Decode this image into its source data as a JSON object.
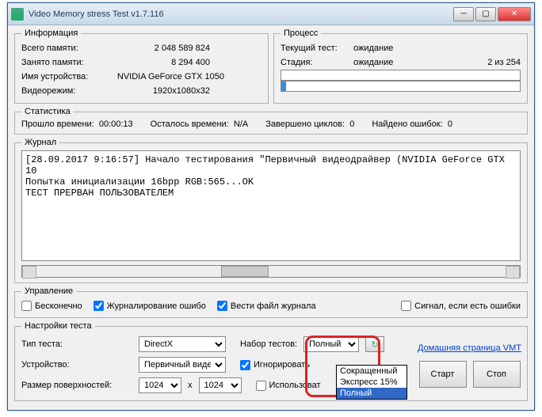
{
  "title": "Video Memory stress Test v1.7.116",
  "info": {
    "legend": "Информация",
    "mem_total_lbl": "Всего памяти:",
    "mem_total": "2 048 589 824",
    "mem_used_lbl": "Занято памяти:",
    "mem_used": "8 294 400",
    "device_lbl": "Имя устройства:",
    "device": "NVIDIA GeForce GTX 1050",
    "mode_lbl": "Видеорежим:",
    "mode": "1920x1080x32"
  },
  "process": {
    "legend": "Процесс",
    "cur_lbl": "Текущий тест:",
    "cur": "ожидание",
    "stage_lbl": "Стадия:",
    "stage": "ожидание",
    "count": "2 из 254"
  },
  "stats": {
    "legend": "Статистика",
    "elapsed_lbl": "Прошло времени:",
    "elapsed": "00:00:13",
    "remain_lbl": "Осталось времени:",
    "remain": "N/A",
    "cycles_lbl": "Завершено циклов:",
    "cycles": "0",
    "errors_lbl": "Найдено ошибок:",
    "errors": "0"
  },
  "log": {
    "legend": "Журнал",
    "text": "[28.09.2017 9:16:57] Начало тестирования \"Первичный видеодрайвер (NVIDIA GeForce GTX 10\nПопытка инициализации 16bpp RGB:565...OK\nТЕСТ ПРЕРВАН ПОЛЬЗОВАТЕЛЕМ"
  },
  "ctrl": {
    "legend": "Управление",
    "infinite": "Бесконечно",
    "log_err": "Журналирование ошибо",
    "log_file": "Вести файл журнала",
    "beep": "Сигнал, если есть ошибки"
  },
  "set": {
    "legend": "Настройки теста",
    "type_lbl": "Тип теста:",
    "type": "DirectX",
    "set_lbl": "Набор тестов:",
    "set_val": "Полный",
    "opts": [
      "Сокращенный",
      "Экспресс 15%",
      "Полный"
    ],
    "dev_lbl": "Устройство:",
    "dev": "Первичный видеод",
    "ignore": "Игнорировать",
    "surf_lbl": "Размер поверхностей:",
    "surf_w": "1024",
    "surf_h": "1024",
    "use": "Использоват"
  },
  "link": "Домашняя страница VMT",
  "btns": {
    "start": "Старт",
    "stop": "Стоп"
  }
}
